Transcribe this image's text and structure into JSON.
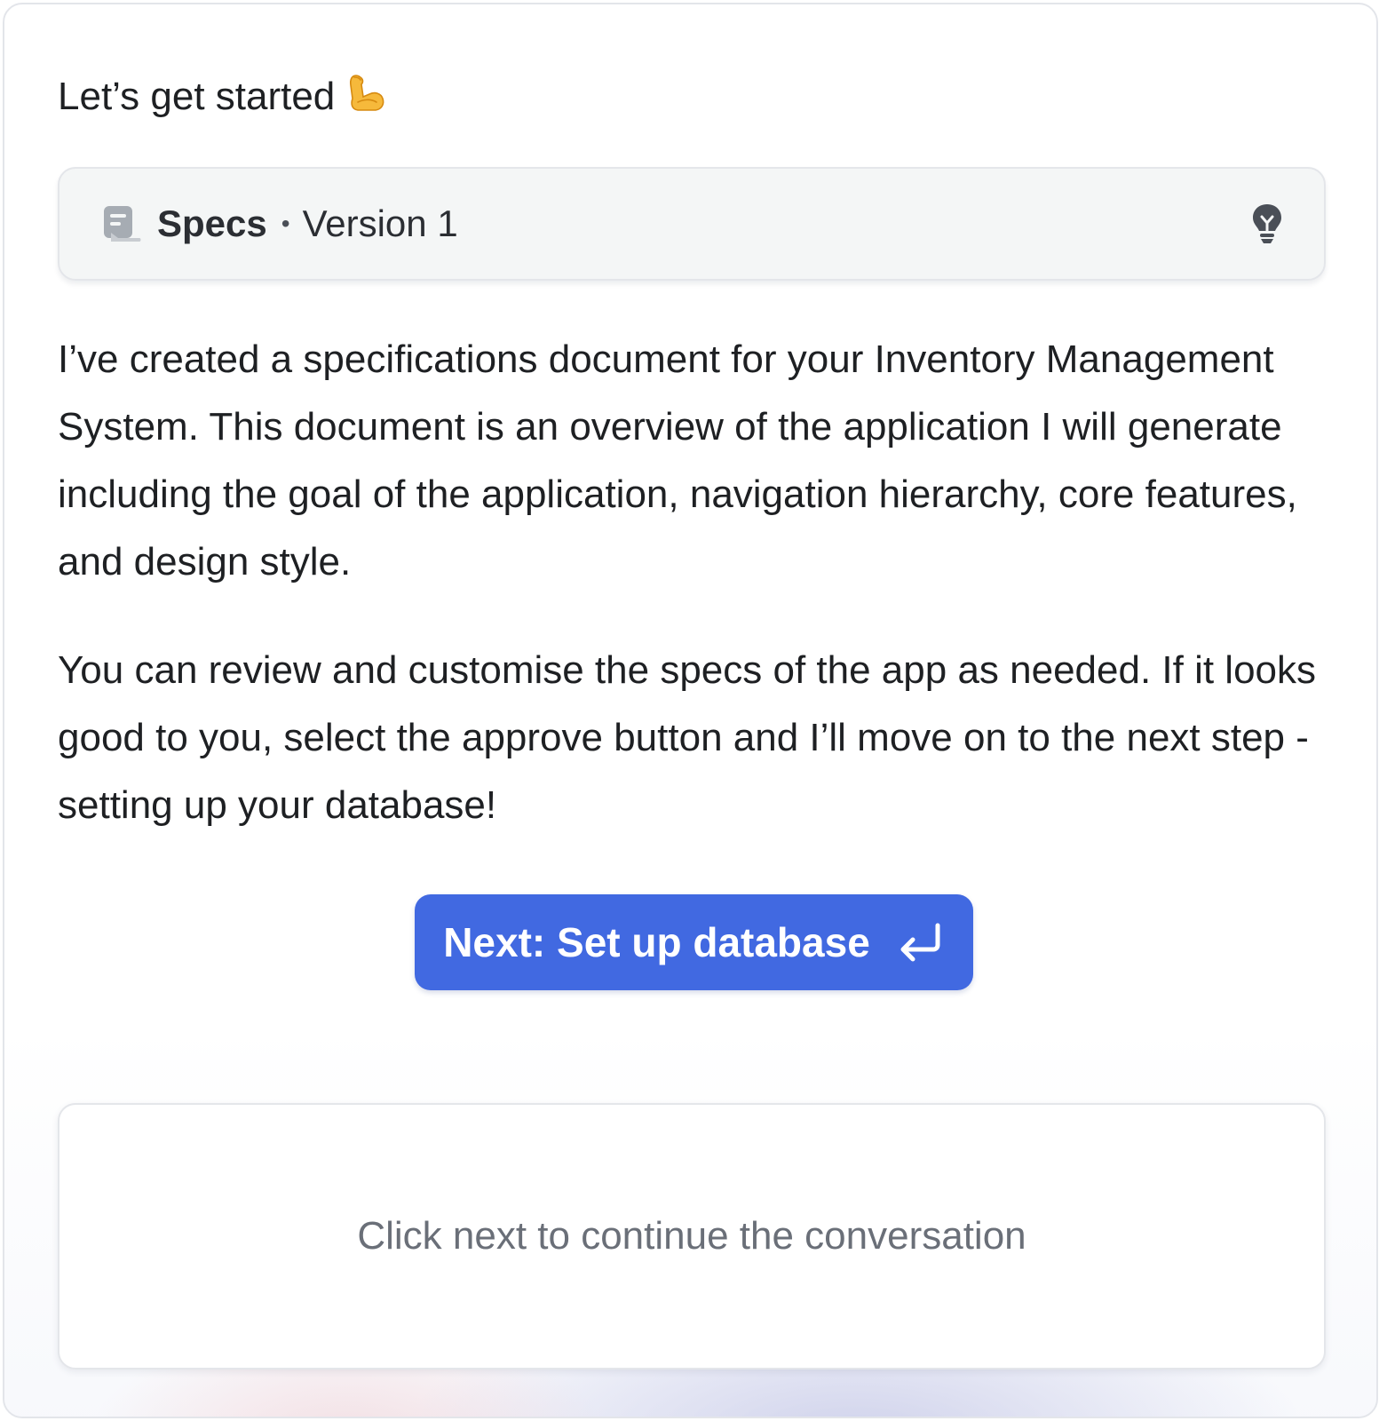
{
  "greeting": {
    "text": "Let’s get started",
    "emoji": "flexed-biceps-icon"
  },
  "spec_card": {
    "icon": "document-icon",
    "title": "Specs",
    "separator": "•",
    "version": "Version 1",
    "action_icon": "lightbulb-icon"
  },
  "message": {
    "paragraph_1": "I’ve created a specifications document for your Inventory Management System. This document is an overview of the application I will generate including the goal of the application, navigation hierarchy, core features, and design style.",
    "paragraph_2": "You can review and customise the specs of the app as needed. If it looks good to you, select the approve button and I’ll move on to the next step - setting up your database!"
  },
  "next_button": {
    "label": "Next: Set up database",
    "icon": "enter-return-icon",
    "color": "#4169e1"
  },
  "chat_input": {
    "placeholder": "Click next to continue the conversation"
  },
  "colors": {
    "text": "#1e2023",
    "card_background": "#f4f6f6",
    "placeholder_text": "#6a6f78",
    "border": "#e3e5ea"
  }
}
